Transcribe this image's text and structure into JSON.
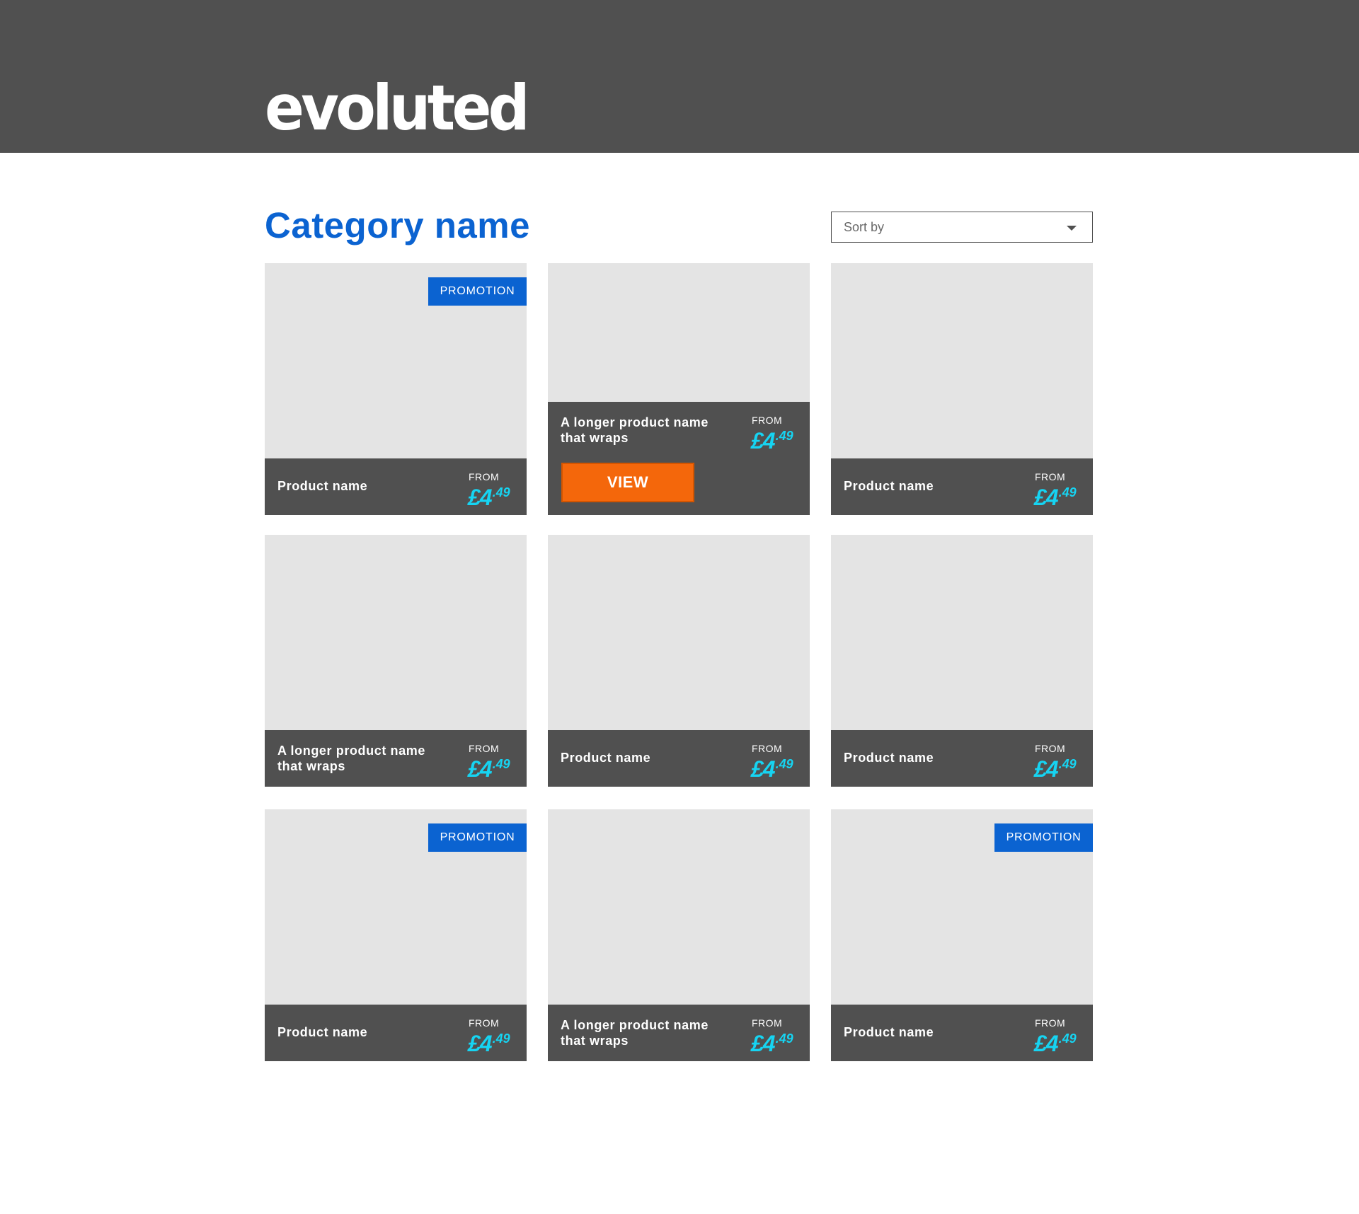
{
  "brand": {
    "logo_text": "evoluted",
    "colors": {
      "header_bg": "#505050",
      "accent_blue": "#0b63d1",
      "price_cyan": "#16d4f2",
      "view_orange": "#f4670b",
      "image_placeholder": "#e4e4e4"
    }
  },
  "page": {
    "title": "Category name",
    "sort": {
      "label": "Sort by",
      "icon": "chevron-down-icon"
    }
  },
  "products": [
    {
      "name": "Product name",
      "from": "FROM",
      "price_main": "£4",
      "price_dec": ".49",
      "promotion": "PROMOTION",
      "view": ""
    },
    {
      "name": "A longer product name that wraps",
      "from": "FROM",
      "price_main": "£4",
      "price_dec": ".49",
      "promotion": "",
      "view": "VIEW"
    },
    {
      "name": "Product name",
      "from": "FROM",
      "price_main": "£4",
      "price_dec": ".49",
      "promotion": "",
      "view": ""
    },
    {
      "name": "A longer product name that wraps",
      "from": "FROM",
      "price_main": "£4",
      "price_dec": ".49",
      "promotion": "",
      "view": ""
    },
    {
      "name": "Product name",
      "from": "FROM",
      "price_main": "£4",
      "price_dec": ".49",
      "promotion": "",
      "view": ""
    },
    {
      "name": "Product name",
      "from": "FROM",
      "price_main": "£4",
      "price_dec": ".49",
      "promotion": "",
      "view": ""
    },
    {
      "name": "Product name",
      "from": "FROM",
      "price_main": "£4",
      "price_dec": ".49",
      "promotion": "PROMOTION",
      "view": ""
    },
    {
      "name": "A longer product name that wraps",
      "from": "FROM",
      "price_main": "£4",
      "price_dec": ".49",
      "promotion": "",
      "view": ""
    },
    {
      "name": "Product name",
      "from": "FROM",
      "price_main": "£4",
      "price_dec": ".49",
      "promotion": "PROMOTION",
      "view": ""
    }
  ]
}
